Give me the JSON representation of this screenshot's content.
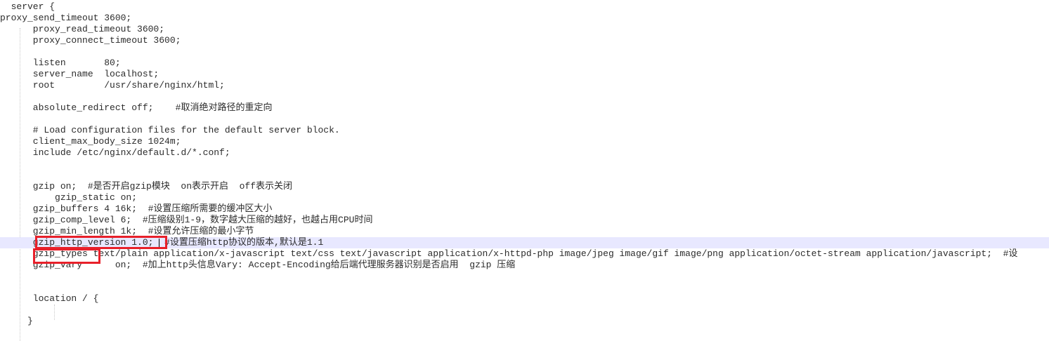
{
  "editor": {
    "lines": [
      "  server {",
      "proxy_send_timeout 3600;",
      "      proxy_read_timeout 3600;",
      "      proxy_connect_timeout 3600;",
      "",
      "      listen       80;",
      "      server_name  localhost;",
      "      root         /usr/share/nginx/html;",
      "",
      "      absolute_redirect off;    #取消绝对路径的重定向",
      "",
      "      # Load configuration files for the default server block.",
      "      client_max_body_size 1024m;",
      "      include /etc/nginx/default.d/*.conf;",
      "",
      "",
      "      gzip on;  #是否开启gzip模块  on表示开启  off表示关闭",
      "          gzip_static on;",
      "      gzip_buffers 4 16k;  #设置压缩所需要的缓冲区大小",
      "      gzip_comp_level 6;  #压缩级别1-9，数字越大压缩的越好，也越占用CPU时间",
      "      gzip_min_length 1k;  #设置允许压缩的最小字节",
      "      gzip_http_version 1.0;  #设置压缩http协议的版本,默认是1.1",
      "      gzip_types text/plain application/x-javascript text/css text/javascript application/x-httpd-php image/jpeg image/gif image/png application/octet-stream application/javascript;  #设",
      "      gzip_vary      on;  #加上http头信息Vary: Accept-Encoding给后端代理服务器识别是否启用  gzip 压缩",
      "",
      "",
      "      location / {",
      "",
      "     }",
      ""
    ],
    "current_line_index": 21,
    "highlight_color": "#e8202a",
    "current_line_color": "#e8e8ff"
  }
}
